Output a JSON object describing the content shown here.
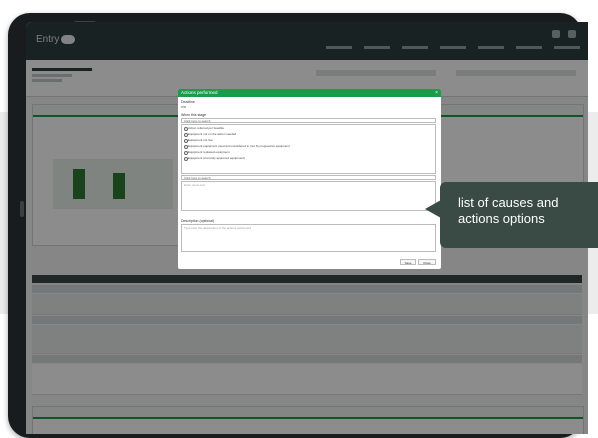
{
  "app": {
    "logo_text": "Entry"
  },
  "modal": {
    "title": "Actions performed",
    "close": "×",
    "deadline_label": "Deadline",
    "deadline_value": "n/a",
    "when_label": "When this stage",
    "select_placeholder": "Click here to search",
    "options": [
      "Action referred per feasible",
      "Equipment not on the action needed",
      "Equipment not live",
      "Equipment equipment used and considered in (not 6) progressive equipment",
      "Equipment replaced equipment",
      "Equipment (currently approved equipment)"
    ],
    "notes_placeholder": "Enter some text",
    "description_label": "Description (optional)",
    "description_placeholder": "Type here the description of the actions performed",
    "save_label": "Save",
    "cancel_label": "Close"
  },
  "callout": {
    "text_line1": "list of causes and",
    "text_line2": "actions options"
  },
  "colors": {
    "accent": "#1a9c4a",
    "callout": "#3a4a44",
    "topbar": "#2d3e3e"
  }
}
